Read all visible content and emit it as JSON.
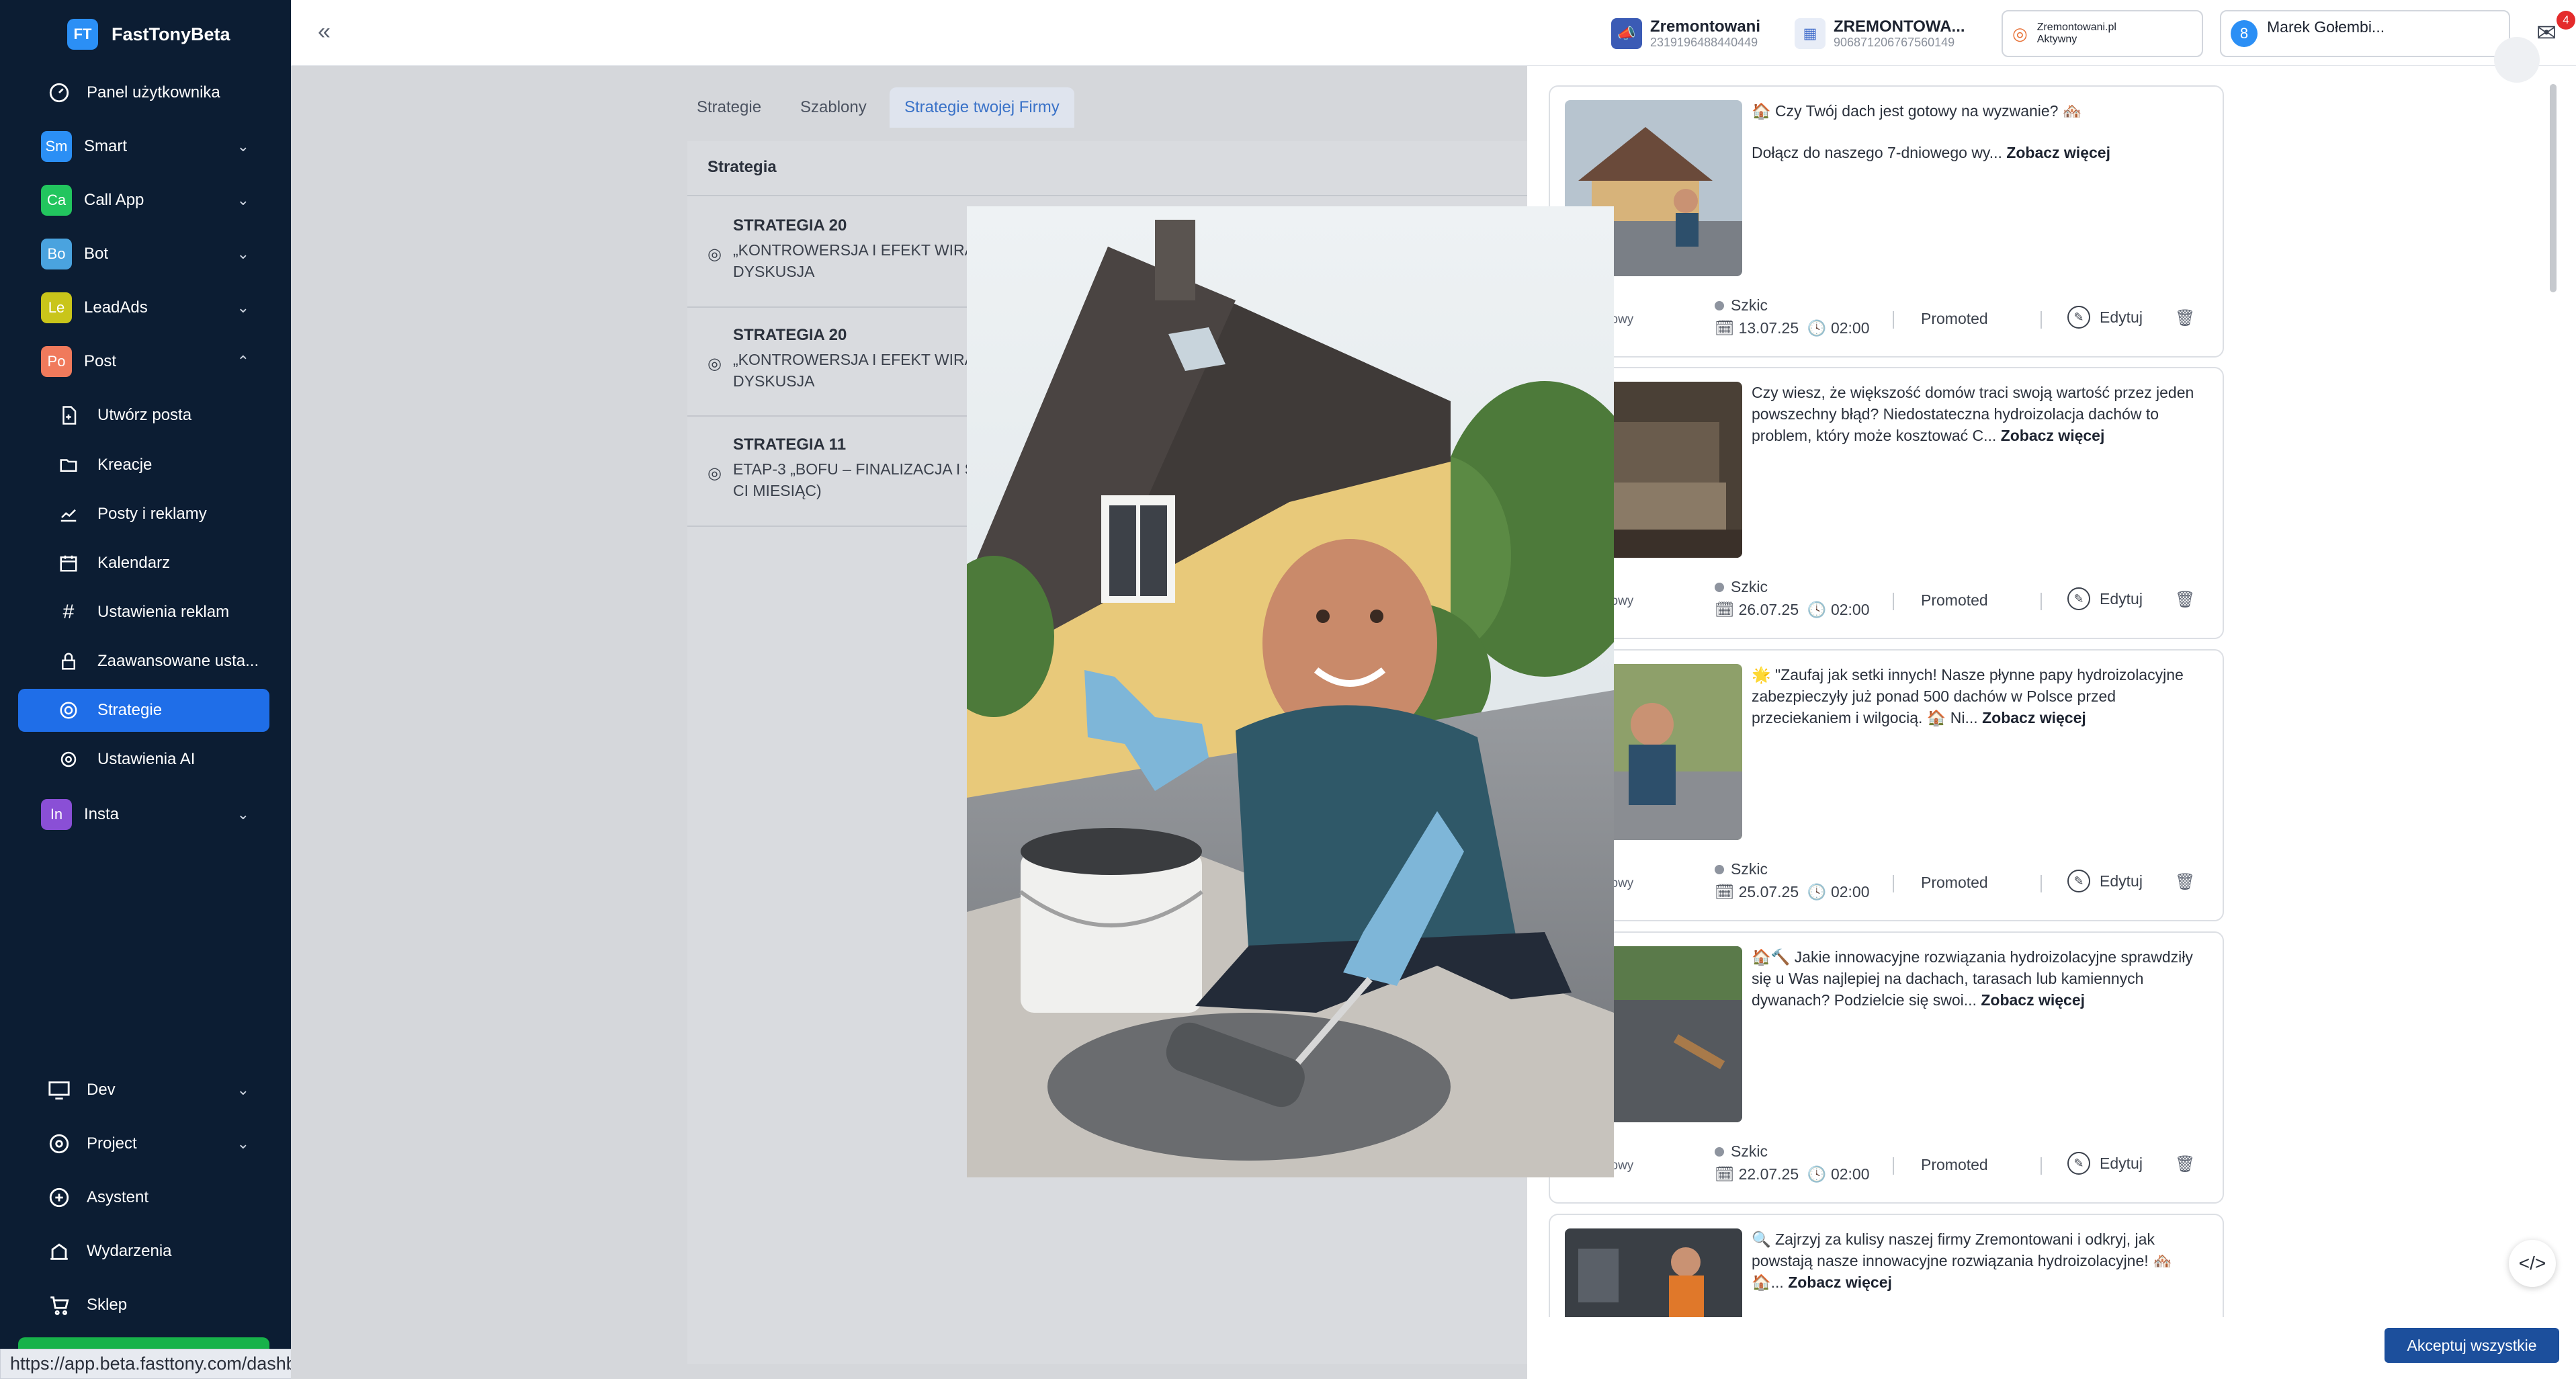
{
  "brand": {
    "logo": "FT",
    "name": "FastTonyBeta"
  },
  "sidebar": {
    "panel": "Panel użytkownika",
    "smart": {
      "badge": "Sm",
      "label": "Smart",
      "color": "#2b8ff5"
    },
    "callapp": {
      "badge": "Ca",
      "label": "Call App",
      "color": "#22c55e"
    },
    "bot": {
      "badge": "Bo",
      "label": "Bot",
      "color": "#4aa3df"
    },
    "leadads": {
      "badge": "Le",
      "label": "LeadAds",
      "color": "#c9c51a"
    },
    "post": {
      "badge": "Po",
      "label": "Post",
      "color": "#f07a5c"
    },
    "sub": [
      "Utwórz posta",
      "Kreacje",
      "Posty i reklamy",
      "Kalendarz",
      "Ustawienia reklam",
      "Zaawansowane usta...",
      "Strategie",
      "Ustawienia AI"
    ],
    "insta": {
      "badge": "In",
      "label": "Insta",
      "color": "#8a4fd6"
    },
    "dev": "Dev",
    "project": "Project",
    "asystent": "Asystent",
    "wydarzenia": "Wydarzenia",
    "sklep": "Sklep"
  },
  "status_url": "https://app.beta.fasttony.com/dashboard",
  "topbar": {
    "acc1": {
      "name": "Zremontowani",
      "id": "2319196488440449"
    },
    "acc2": {
      "name": "ZREMONTOWA...",
      "id": "906871206767560149"
    },
    "acc3": {
      "name": "Zremontowani.pl",
      "status": "Aktywny"
    },
    "user": {
      "avatar": "8",
      "name": "Marek Gołembi..."
    },
    "mail_count": "4"
  },
  "tabs": [
    "Strategie",
    "Szablony",
    "Strategie twojej Firmy"
  ],
  "table": {
    "header": "Strategia",
    "rows": [
      {
        "title": "STRATEGIA 20",
        "desc1": "„KONTROWERSJA I EFEKT WIRA",
        "desc2": "DYSKUSJA"
      },
      {
        "title": "STRATEGIA 20",
        "desc1": "„KONTROWERSJA I EFEKT WIRA",
        "desc2": "DYSKUSJA"
      },
      {
        "title": "STRATEGIA 11",
        "desc1": "ETAP-3 „BOFU – FINALIZACJA I S",
        "desc2": "CI MIESIĄC)"
      }
    ]
  },
  "posts": [
    {
      "text": "🏠 Czy Twój dach jest gotowy na wyzwanie? 🏘️",
      "text2": "Dołącz do naszego 7-dniowego wy...",
      "more": "Zobacz więcej",
      "partial": "łęciowy",
      "status": "Szkic",
      "date": "13.07.25",
      "time": "02:00",
      "promo": "Promoted",
      "edit": "Edytuj"
    },
    {
      "text": "Czy wiesz, że większość domów traci swoją wartość przez jeden powszechny błąd? Niedostateczna hydroizolacja dachów to problem, który może kosztować C...",
      "more": "Zobacz więcej",
      "partial": "łęciowy",
      "status": "Szkic",
      "date": "26.07.25",
      "time": "02:00",
      "promo": "Promoted",
      "edit": "Edytuj"
    },
    {
      "text": "🌟 \"Zaufaj jak setki innych! Nasze płynne papy hydroizolacyjne zabezpieczyły już ponad 500 dachów w Polsce przed przeciekaniem i wilgocią. 🏠 Ni...",
      "more": "Zobacz więcej",
      "partial": "łęciowy",
      "status": "Szkic",
      "date": "25.07.25",
      "time": "02:00",
      "promo": "Promoted",
      "edit": "Edytuj"
    },
    {
      "text": "🏠🔨 Jakie innowacyjne rozwiązania hydroizolacyjne sprawdziły się u Was najlepiej na dachach, tarasach lub kamiennych dywanach? Podzielcie się swoi...",
      "more": "Zobacz więcej",
      "partial": "łęciowy",
      "status": "Szkic",
      "date": "22.07.25",
      "time": "02:00",
      "promo": "Promoted",
      "edit": "Edytuj"
    },
    {
      "text": "🔍 Zajrzyj za kulisy naszej firmy Zremontowani i odkryj, jak powstają nasze innowacyjne rozwiązania hydroizolacyjne! 🏘️",
      "text2": "🏠...",
      "more": "Zobacz więcej"
    }
  ],
  "accept_all": "Akceptuj wszystkie"
}
